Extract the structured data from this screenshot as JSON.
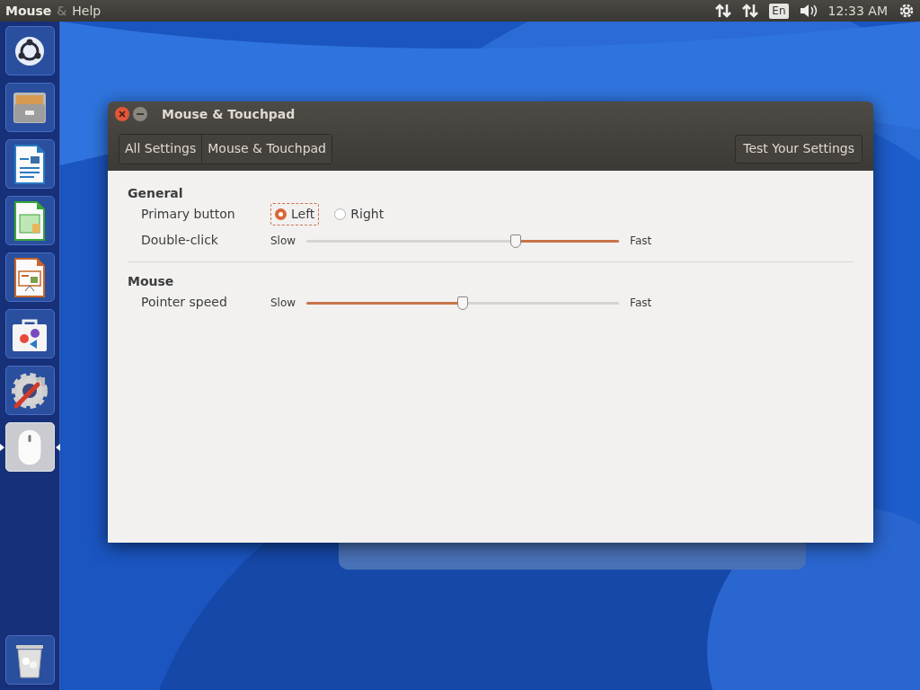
{
  "top_bar": {
    "app_name": "Mouse",
    "menu": [
      {
        "label": "&",
        "dim": true
      },
      {
        "label": "Help",
        "dim": false
      }
    ],
    "keyboard_layout": "En",
    "clock": "12:33 AM"
  },
  "launcher": {
    "items": [
      {
        "kind": "dash",
        "active": false
      },
      {
        "kind": "files",
        "active": false
      },
      {
        "kind": "writer",
        "active": false
      },
      {
        "kind": "calc",
        "active": false
      },
      {
        "kind": "impress",
        "active": false
      },
      {
        "kind": "store",
        "active": false
      },
      {
        "kind": "settings",
        "active": false
      },
      {
        "kind": "mouse",
        "active": true
      }
    ],
    "trash": {
      "kind": "trash"
    }
  },
  "window": {
    "title": "Mouse & Touchpad",
    "breadcrumbs": [
      "All Settings",
      "Mouse & Touchpad"
    ],
    "test_button": "Test Your Settings",
    "sections": [
      {
        "title": "General",
        "rows": [
          {
            "kind": "radio",
            "label": "Primary button",
            "options": [
              {
                "label": "Left",
                "selected": true
              },
              {
                "label": "Right",
                "selected": false
              }
            ]
          },
          {
            "kind": "slider",
            "label": "Double-click",
            "min_label": "Slow",
            "max_label": "Fast",
            "level": 0.67,
            "fill_from_right": true
          }
        ]
      },
      {
        "title": "Mouse",
        "rows": [
          {
            "kind": "slider",
            "label": "Pointer speed",
            "min_label": "Slow",
            "max_label": "Fast",
            "level": 0.5,
            "fill_from_right": false
          }
        ]
      }
    ]
  }
}
